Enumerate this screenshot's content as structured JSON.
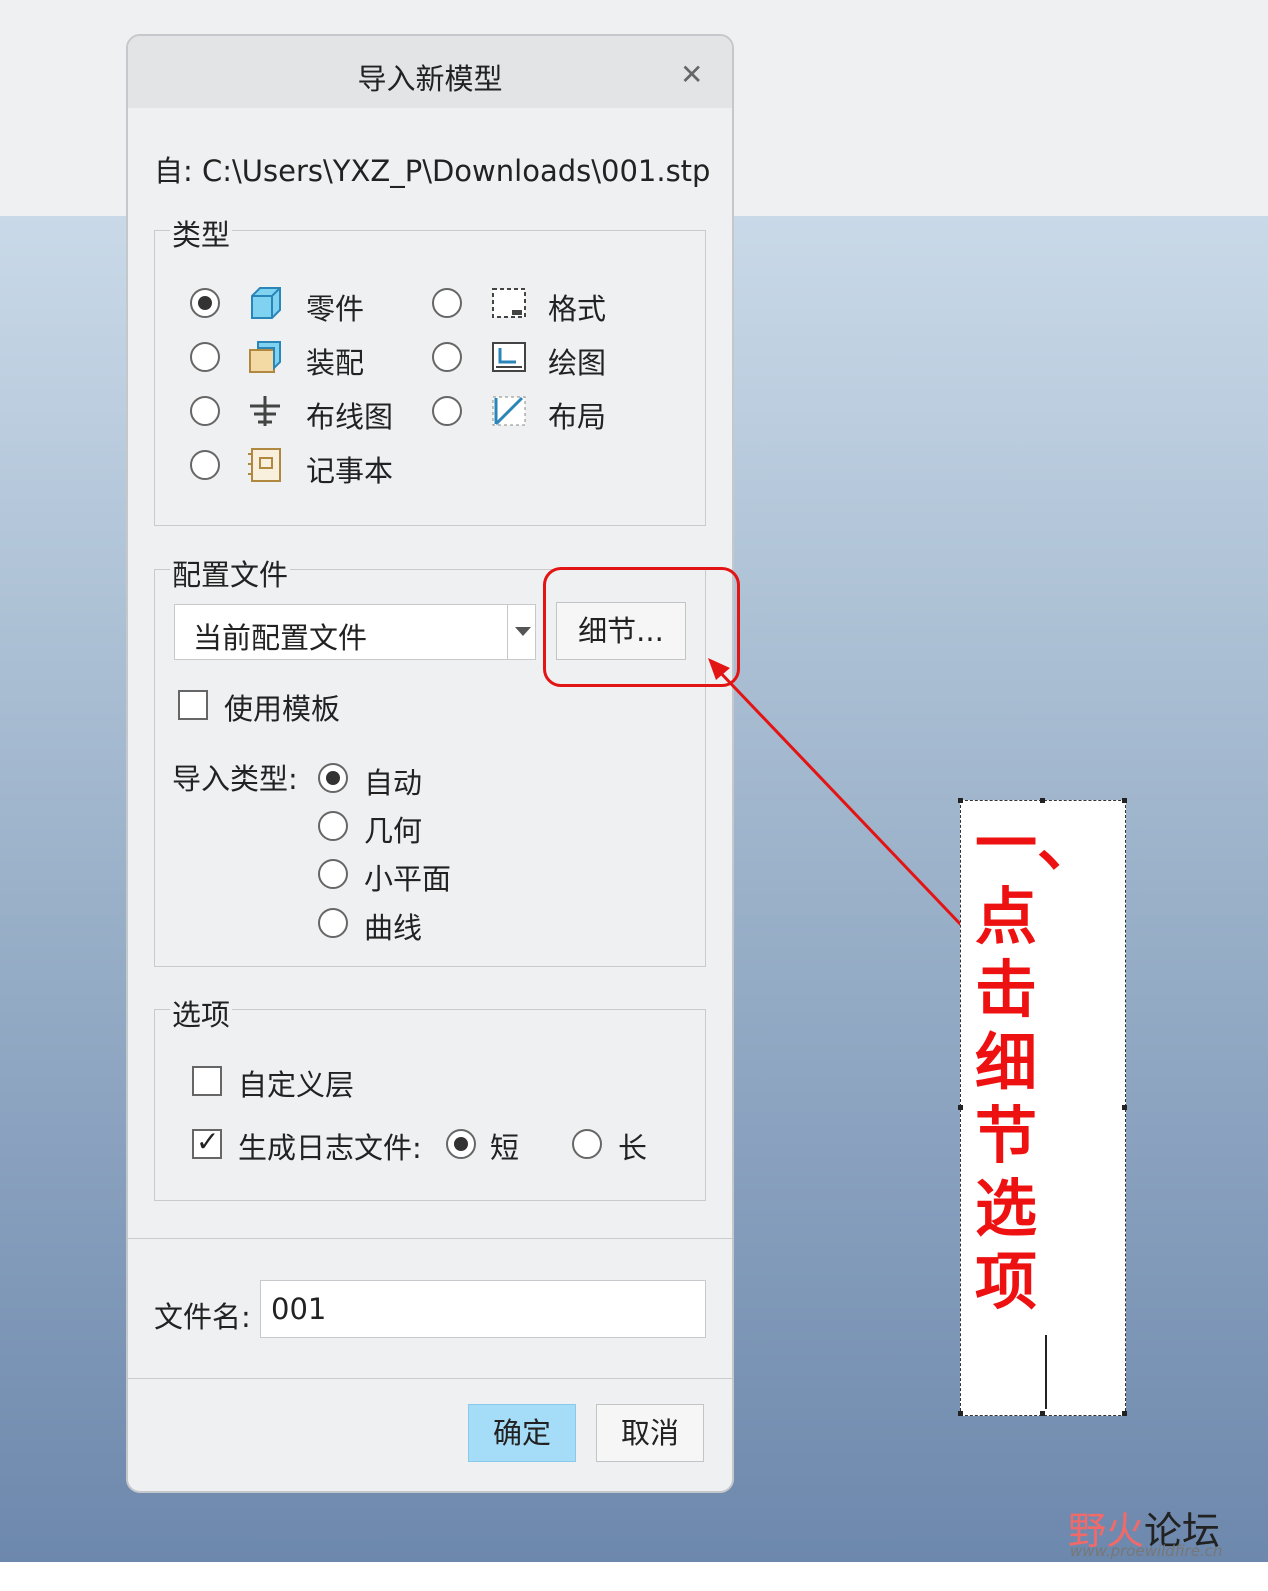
{
  "dialog": {
    "title": "导入新模型",
    "from_label": "自:",
    "from_path": "C:\\Users\\YXZ_P\\Downloads\\001.stp",
    "type_group": {
      "legend": "类型",
      "options": [
        {
          "label": "零件",
          "icon": "part-icon",
          "selected": true
        },
        {
          "label": "装配",
          "icon": "assembly-icon",
          "selected": false
        },
        {
          "label": "布线图",
          "icon": "diagram-icon",
          "selected": false
        },
        {
          "label": "记事本",
          "icon": "notebook-icon",
          "selected": false
        },
        {
          "label": "格式",
          "icon": "format-icon",
          "selected": false
        },
        {
          "label": "绘图",
          "icon": "drawing-icon",
          "selected": false
        },
        {
          "label": "布局",
          "icon": "layout-icon",
          "selected": false
        }
      ]
    },
    "profile_group": {
      "legend": "配置文件",
      "profile_value": "当前配置文件",
      "details_button": "细节...",
      "use_template_label": "使用模板",
      "use_template_checked": false,
      "import_type_label": "导入类型:",
      "import_types": [
        {
          "label": "自动",
          "selected": true
        },
        {
          "label": "几何",
          "selected": false
        },
        {
          "label": "小平面",
          "selected": false
        },
        {
          "label": "曲线",
          "selected": false
        }
      ]
    },
    "options_group": {
      "legend": "选项",
      "custom_layer_label": "自定义层",
      "custom_layer_checked": false,
      "log_file_label": "生成日志文件:",
      "log_file_checked": true,
      "log_short_label": "短",
      "log_short_selected": true,
      "log_long_label": "长",
      "log_long_selected": false
    },
    "filename_label": "文件名:",
    "filename_value": "001",
    "ok_button": "确定",
    "cancel_button": "取消"
  },
  "annotation": {
    "text": "一、点击细节选项",
    "color": "#ee1111"
  },
  "watermark": {
    "prefix": "野火",
    "suffix": "论坛",
    "url": "www.proewildfire.cn"
  }
}
